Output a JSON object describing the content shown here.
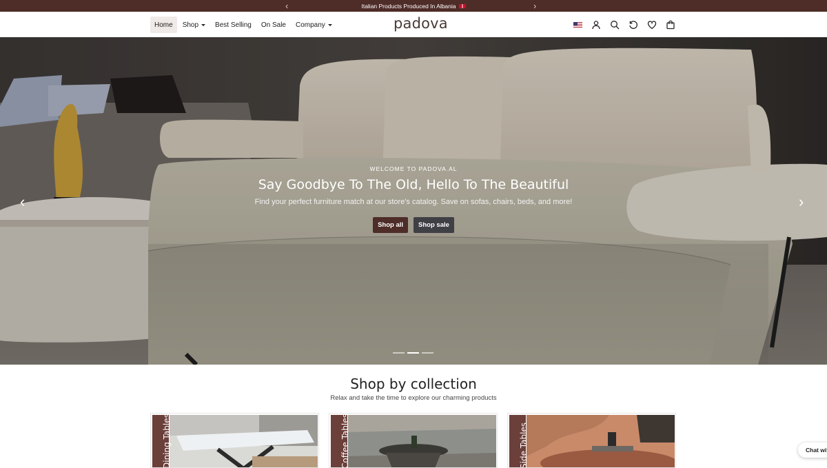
{
  "announcement": {
    "text": "Italian Products Produced In Albania",
    "prev_icon": "chevron-left-icon",
    "next_icon": "chevron-right-icon"
  },
  "header": {
    "nav": [
      {
        "label": "Home",
        "active": true,
        "dropdown": false
      },
      {
        "label": "Shop",
        "active": false,
        "dropdown": true
      },
      {
        "label": "Best Selling",
        "active": false,
        "dropdown": false
      },
      {
        "label": "On Sale",
        "active": false,
        "dropdown": false
      },
      {
        "label": "Company",
        "active": false,
        "dropdown": true
      }
    ],
    "logo": "padova",
    "icons": [
      "us-flag-icon",
      "account-icon",
      "search-icon",
      "recently-viewed-icon",
      "wishlist-icon",
      "cart-icon"
    ]
  },
  "hero": {
    "eyebrow": "WELCOME TO PADOVA.AL",
    "headline": "Say Goodbye To The Old, Hello To The Beautiful",
    "subtext": "Find your perfect furniture match at our store's catalog. Save on sofas, chairs, beds, and more!",
    "primary_cta": "Shop all",
    "secondary_cta": "Shop sale",
    "slides": 3,
    "active_slide": 2
  },
  "collections": {
    "title": "Shop by collection",
    "subtitle": "Relax and take the time to explore our charming products",
    "cards": [
      {
        "label": "Dining Tables"
      },
      {
        "label": "Coffee Tables"
      },
      {
        "label": "Side Tables"
      }
    ]
  },
  "chat": {
    "label": "Chat with us"
  },
  "colors": {
    "brand": "#4e2c28",
    "secondary": "#3f3f46",
    "band": "#6b3f3a"
  }
}
